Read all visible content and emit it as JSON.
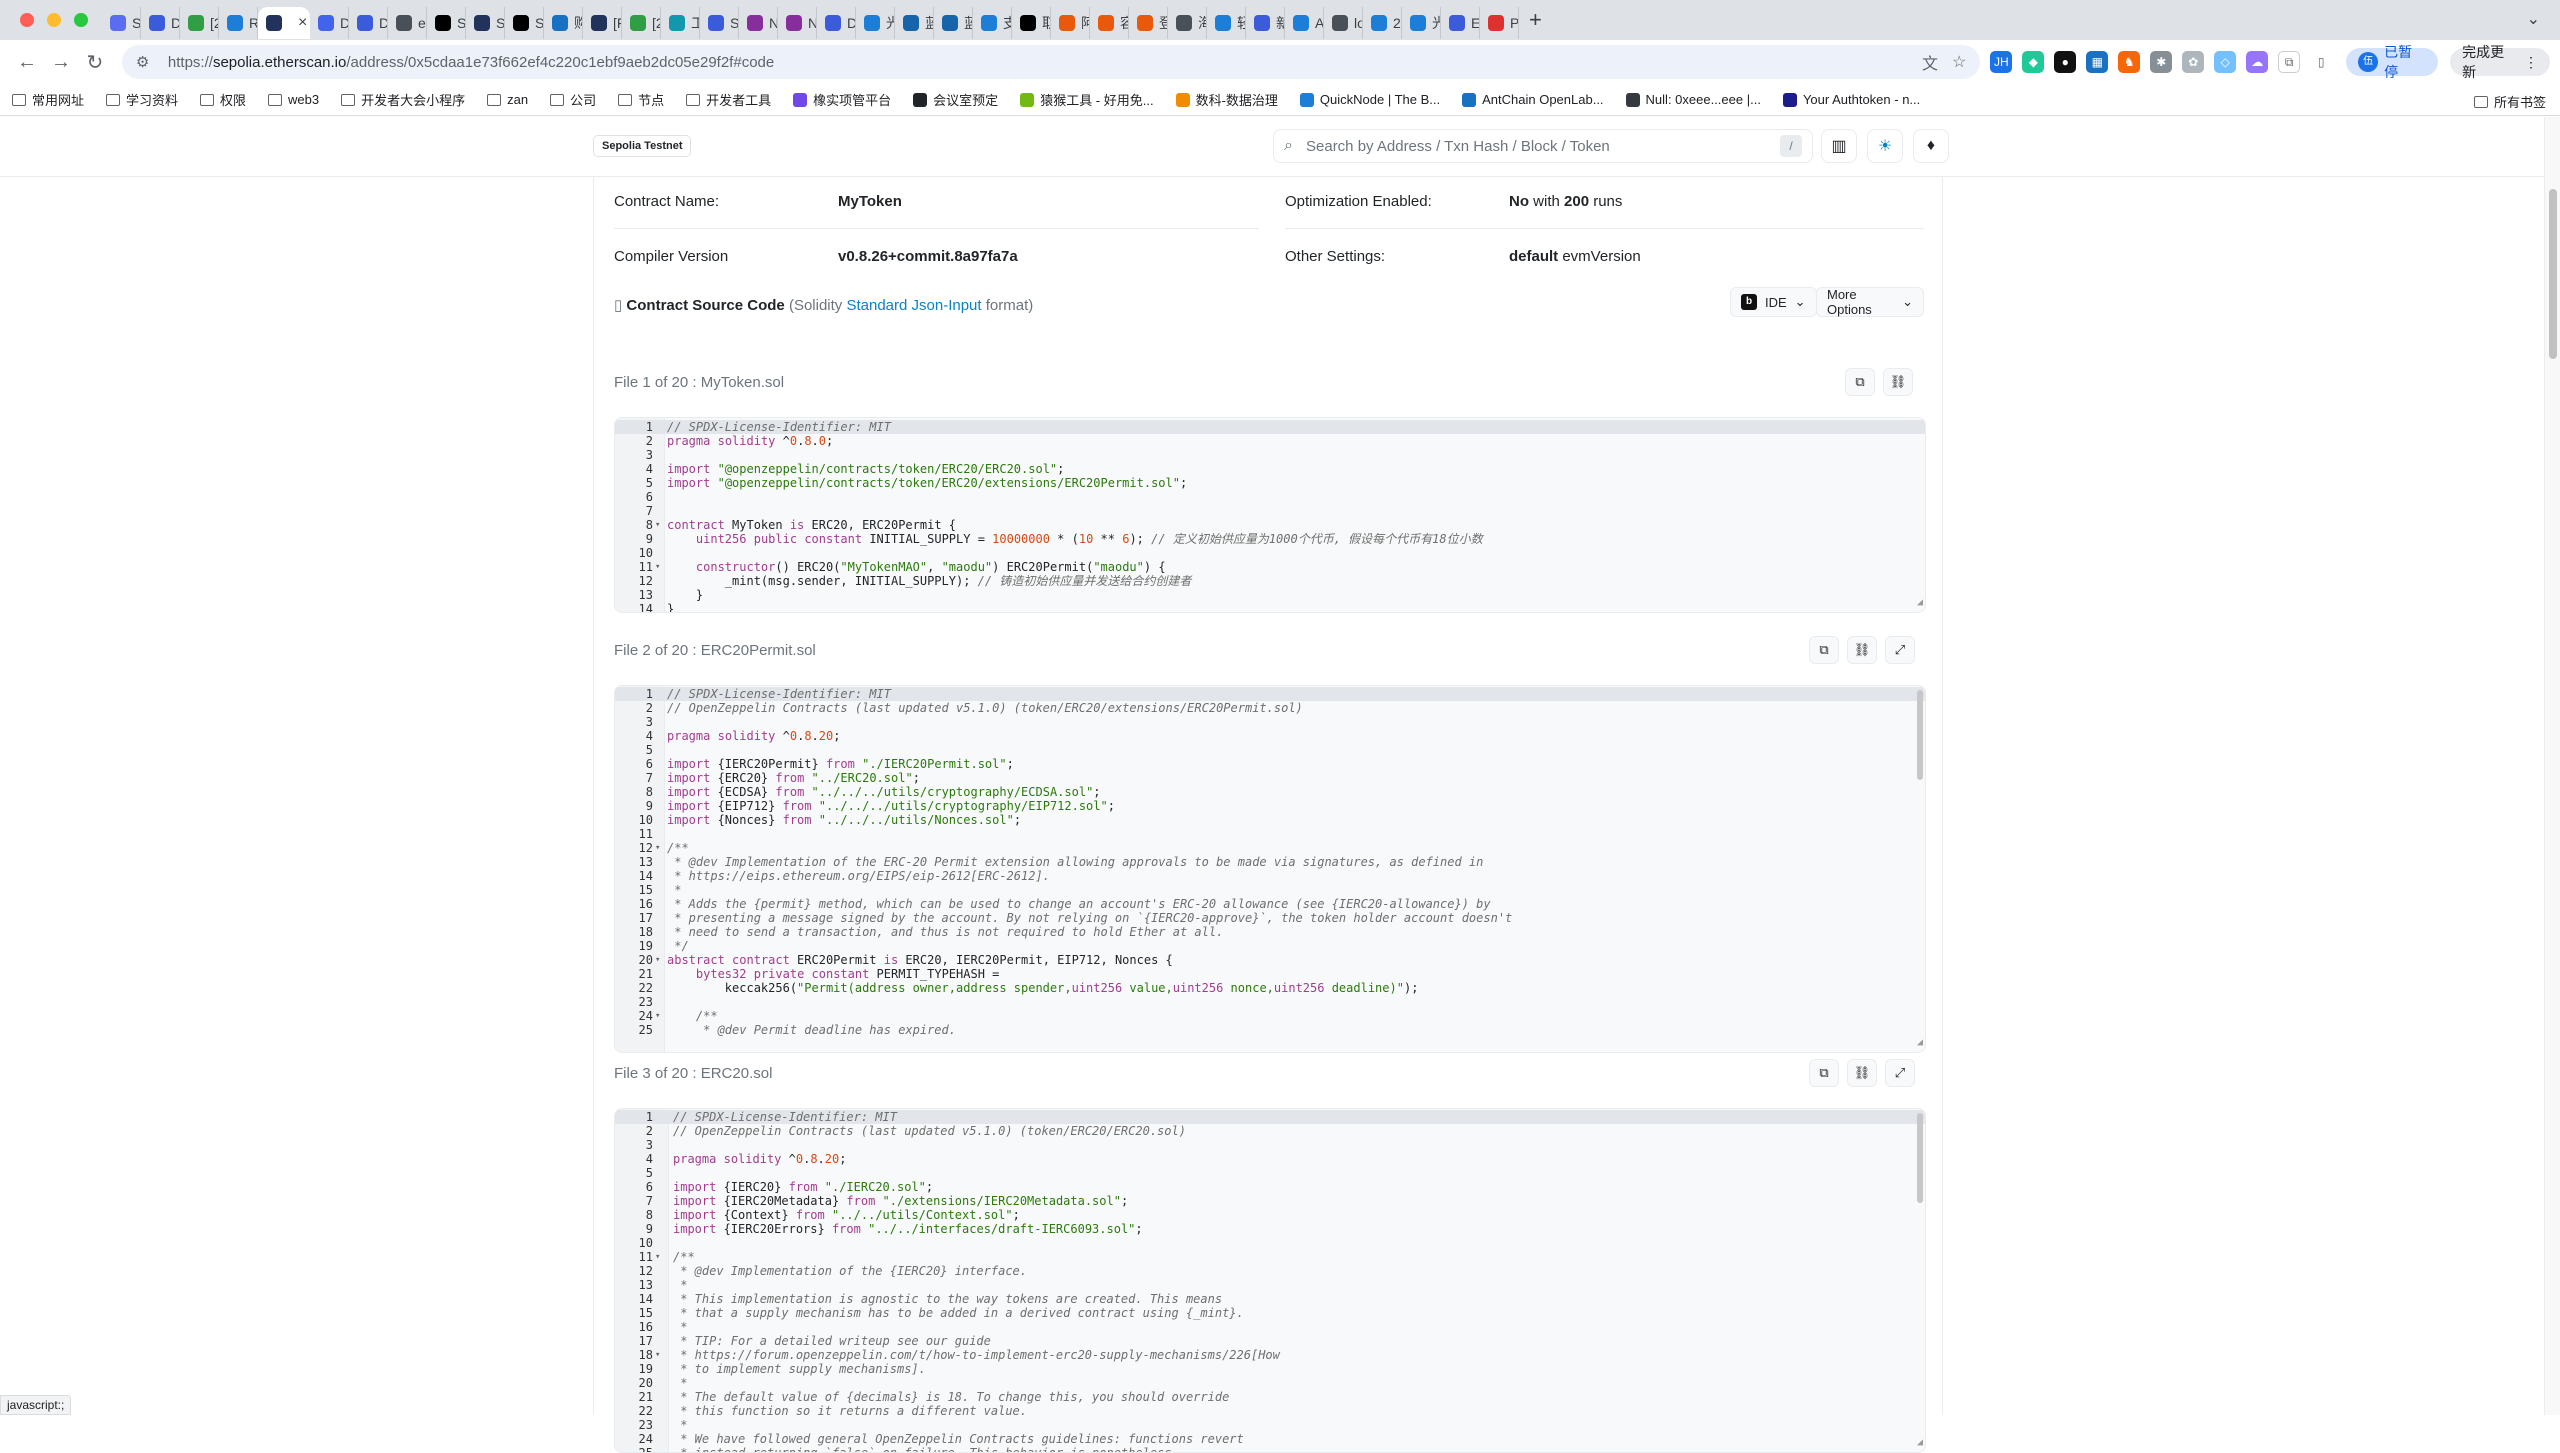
{
  "browser": {
    "tabs": [
      {
        "label": "Se",
        "color": "#5a6cf0"
      },
      {
        "label": "DM",
        "color": "#3b5bdb"
      },
      {
        "label": "[2",
        "color": "#2f9e44"
      },
      {
        "label": "Re",
        "color": "#1c7ed6"
      },
      {
        "label": "",
        "color": "#21325b",
        "active": true
      },
      {
        "label": "Da",
        "color": "#4263eb"
      },
      {
        "label": "DM",
        "color": "#3b5bdb"
      },
      {
        "label": "eth",
        "color": "#495057"
      },
      {
        "label": "Se",
        "color": "#000000"
      },
      {
        "label": "Se",
        "color": "#21325b"
      },
      {
        "label": "Se",
        "color": "#000000"
      },
      {
        "label": "购买",
        "color": "#1971c2"
      },
      {
        "label": "[F",
        "color": "#21325b"
      },
      {
        "label": "[2",
        "color": "#2f9e44"
      },
      {
        "label": "工作",
        "color": "#1098ad"
      },
      {
        "label": "SQ",
        "color": "#3b5bdb"
      },
      {
        "label": "No",
        "color": "#862e9c"
      },
      {
        "label": "No",
        "color": "#862e9c"
      },
      {
        "label": "DM",
        "color": "#3b5bdb"
      },
      {
        "label": "光寸",
        "color": "#1c7ed6"
      },
      {
        "label": "蓝领",
        "color": "#1864ab"
      },
      {
        "label": "蓝领",
        "color": "#1864ab"
      },
      {
        "label": "支付",
        "color": "#1c7ed6"
      },
      {
        "label": "取消",
        "color": "#000000"
      },
      {
        "label": "阿里",
        "color": "#e8590c"
      },
      {
        "label": "容器",
        "color": "#e8590c"
      },
      {
        "label": "登录",
        "color": "#e8590c"
      },
      {
        "label": "海外",
        "color": "#495057"
      },
      {
        "label": "轻松",
        "color": "#1c7ed6"
      },
      {
        "label": "新特",
        "color": "#3b5bdb"
      },
      {
        "label": "An",
        "color": "#1c7ed6"
      },
      {
        "label": "loc",
        "color": "#495057"
      },
      {
        "label": "20",
        "color": "#1c7ed6"
      },
      {
        "label": "光寸",
        "color": "#1c7ed6"
      },
      {
        "label": "Eth",
        "color": "#3b5bdb"
      },
      {
        "label": "Ple",
        "color": "#e03131"
      }
    ],
    "url_prefix": "https://",
    "url_host": "sepolia.etherscan.io",
    "url_path": "/address/0x5cdaa1e73f662ef4c220c1ebf9aeb2dc05e29f2f#code",
    "paused_label": "已暂停",
    "update_label": "完成更新",
    "bookmarks": [
      {
        "label": "常用网址",
        "type": "folder"
      },
      {
        "label": "学习资料",
        "type": "folder"
      },
      {
        "label": "权限",
        "type": "folder"
      },
      {
        "label": "web3",
        "type": "folder"
      },
      {
        "label": "开发者大会小程序",
        "type": "folder"
      },
      {
        "label": "zan",
        "type": "folder"
      },
      {
        "label": "公司",
        "type": "folder"
      },
      {
        "label": "节点",
        "type": "folder"
      },
      {
        "label": "开发者工具",
        "type": "folder"
      },
      {
        "label": "橡实项管平台",
        "type": "site",
        "color": "#7048e8"
      },
      {
        "label": "会议室预定",
        "type": "site",
        "color": "#212529"
      },
      {
        "label": "猿猴工具 - 好用免...",
        "type": "site",
        "color": "#74b816"
      },
      {
        "label": "数科-数据治理",
        "type": "site",
        "color": "#f08c00"
      },
      {
        "label": "QuickNode | The B...",
        "type": "site",
        "color": "#1c7ed6"
      },
      {
        "label": "AntChain OpenLab...",
        "type": "site",
        "color": "#1971c2"
      },
      {
        "label": "Null: 0xeee...eee |...",
        "type": "site",
        "color": "#343a40"
      },
      {
        "label": "Your Authtoken - n...",
        "type": "site",
        "color": "#1c1c8c"
      }
    ],
    "all_bookmarks": "所有书签",
    "status_text": "javascript:;"
  },
  "header": {
    "network": "Sepolia Testnet",
    "search_placeholder": "Search by Address / Txn Hash / Block / Token",
    "slash": "/"
  },
  "contract": {
    "name_label": "Contract Name:",
    "name_value": "MyToken",
    "opt_label": "Optimization Enabled:",
    "opt_value_no": "No",
    "opt_with": " with ",
    "opt_runs": "200",
    "opt_runs_label": " runs",
    "compiler_label": "Compiler Version",
    "compiler_value": "v0.8.26+commit.8a97fa7a",
    "other_label": "Other Settings:",
    "other_default": "default",
    "other_evm": " evmVersion",
    "source_title": "Contract Source Code",
    "source_paren_open": " (Solidity ",
    "source_link": "Standard Json-Input",
    "source_paren_close": " format)",
    "ide_label": "IDE",
    "more_label": "More Options"
  },
  "files": [
    {
      "title": "File 1 of 20 : MyToken.sol",
      "lines": [
        {
          "n": "1",
          "t": "// SPDX-License-Identifier: MIT",
          "c": "cm"
        },
        {
          "n": "2",
          "t": "pragma solidity ^0.8.0;"
        },
        {
          "n": "3",
          "t": ""
        },
        {
          "n": "4",
          "t": "import \"@openzeppelin/contracts/token/ERC20/ERC20.sol\";"
        },
        {
          "n": "5",
          "t": "import \"@openzeppelin/contracts/token/ERC20/extensions/ERC20Permit.sol\";"
        },
        {
          "n": "6",
          "t": ""
        },
        {
          "n": "7",
          "t": ""
        },
        {
          "n": "8",
          "t": "contract MyToken is ERC20, ERC20Permit {",
          "f": true
        },
        {
          "n": "9",
          "t": "    uint256 public constant INITIAL_SUPPLY = 10000000 * (10 ** 6); // 定义初始供应量为1000个代币, 假设每个代币有18位小数"
        },
        {
          "n": "10",
          "t": ""
        },
        {
          "n": "11",
          "t": "    constructor() ERC20(\"MyTokenMAO\", \"maodu\") ERC20Permit(\"maodu\") {",
          "f": true
        },
        {
          "n": "12",
          "t": "        _mint(msg.sender, INITIAL_SUPPLY); // 铸造初始供应量并发送给合约创建者"
        },
        {
          "n": "13",
          "t": "    }"
        },
        {
          "n": "14",
          "t": "}"
        }
      ]
    },
    {
      "title": "File 2 of 20 : ERC20Permit.sol",
      "lines": [
        {
          "n": "1",
          "t": "// SPDX-License-Identifier: MIT",
          "c": "cm"
        },
        {
          "n": "2",
          "t": "// OpenZeppelin Contracts (last updated v5.1.0) (token/ERC20/extensions/ERC20Permit.sol)",
          "c": "cm"
        },
        {
          "n": "3",
          "t": ""
        },
        {
          "n": "4",
          "t": "pragma solidity ^0.8.20;"
        },
        {
          "n": "5",
          "t": ""
        },
        {
          "n": "6",
          "t": "import {IERC20Permit} from \"./IERC20Permit.sol\";"
        },
        {
          "n": "7",
          "t": "import {ERC20} from \"../ERC20.sol\";"
        },
        {
          "n": "8",
          "t": "import {ECDSA} from \"../../../utils/cryptography/ECDSA.sol\";"
        },
        {
          "n": "9",
          "t": "import {EIP712} from \"../../../utils/cryptography/EIP712.sol\";"
        },
        {
          "n": "10",
          "t": "import {Nonces} from \"../../../utils/Nonces.sol\";"
        },
        {
          "n": "11",
          "t": ""
        },
        {
          "n": "12",
          "t": "/**",
          "c": "cm",
          "f": true
        },
        {
          "n": "13",
          "t": " * @dev Implementation of the ERC-20 Permit extension allowing approvals to be made via signatures, as defined in",
          "c": "cm"
        },
        {
          "n": "14",
          "t": " * https://eips.ethereum.org/EIPS/eip-2612[ERC-2612].",
          "c": "cm"
        },
        {
          "n": "15",
          "t": " *",
          "c": "cm"
        },
        {
          "n": "16",
          "t": " * Adds the {permit} method, which can be used to change an account's ERC-20 allowance (see {IERC20-allowance}) by",
          "c": "cm"
        },
        {
          "n": "17",
          "t": " * presenting a message signed by the account. By not relying on `{IERC20-approve}`, the token holder account doesn't",
          "c": "cm"
        },
        {
          "n": "18",
          "t": " * need to send a transaction, and thus is not required to hold Ether at all.",
          "c": "cm"
        },
        {
          "n": "19",
          "t": " */",
          "c": "cm"
        },
        {
          "n": "20",
          "t": "abstract contract ERC20Permit is ERC20, IERC20Permit, EIP712, Nonces {",
          "f": true
        },
        {
          "n": "21",
          "t": "    bytes32 private constant PERMIT_TYPEHASH ="
        },
        {
          "n": "22",
          "t": "        keccak256(\"Permit(address owner,address spender,uint256 value,uint256 nonce,uint256 deadline)\");"
        },
        {
          "n": "23",
          "t": ""
        },
        {
          "n": "24",
          "t": "    /**",
          "c": "cm",
          "f": true
        },
        {
          "n": "25",
          "t": "     * @dev Permit deadline has expired.",
          "c": "cm"
        }
      ]
    },
    {
      "title": "File 3 of 20 : ERC20.sol",
      "lines": [
        {
          "n": "1",
          "t": "// SPDX-License-Identifier: MIT",
          "c": "cm"
        },
        {
          "n": "2",
          "t": "// OpenZeppelin Contracts (last updated v5.1.0) (token/ERC20/ERC20.sol)",
          "c": "cm"
        },
        {
          "n": "3",
          "t": ""
        },
        {
          "n": "4",
          "t": "pragma solidity ^0.8.20;"
        },
        {
          "n": "5",
          "t": ""
        },
        {
          "n": "6",
          "t": "import {IERC20} from \"./IERC20.sol\";"
        },
        {
          "n": "7",
          "t": "import {IERC20Metadata} from \"./extensions/IERC20Metadata.sol\";"
        },
        {
          "n": "8",
          "t": "import {Context} from \"../../utils/Context.sol\";"
        },
        {
          "n": "9",
          "t": "import {IERC20Errors} from \"../../interfaces/draft-IERC6093.sol\";"
        },
        {
          "n": "10",
          "t": ""
        },
        {
          "n": "11",
          "t": "/**",
          "c": "cm",
          "f": true
        },
        {
          "n": "12",
          "t": " * @dev Implementation of the {IERC20} interface.",
          "c": "cm"
        },
        {
          "n": "13",
          "t": " *",
          "c": "cm"
        },
        {
          "n": "14",
          "t": " * This implementation is agnostic to the way tokens are created. This means",
          "c": "cm"
        },
        {
          "n": "15",
          "t": " * that a supply mechanism has to be added in a derived contract using {_mint}.",
          "c": "cm"
        },
        {
          "n": "16",
          "t": " *",
          "c": "cm"
        },
        {
          "n": "17",
          "t": " * TIP: For a detailed writeup see our guide",
          "c": "cm"
        },
        {
          "n": "18",
          "t": " * https://forum.openzeppelin.com/t/how-to-implement-erc20-supply-mechanisms/226[How",
          "c": "cm",
          "f": true
        },
        {
          "n": "19",
          "t": " * to implement supply mechanisms].",
          "c": "cm"
        },
        {
          "n": "20",
          "t": " *",
          "c": "cm"
        },
        {
          "n": "21",
          "t": " * The default value of {decimals} is 18. To change this, you should override",
          "c": "cm"
        },
        {
          "n": "22",
          "t": " * this function so it returns a different value.",
          "c": "cm"
        },
        {
          "n": "23",
          "t": " *",
          "c": "cm"
        },
        {
          "n": "24",
          "t": " * We have followed general OpenZeppelin Contracts guidelines: functions revert",
          "c": "cm"
        },
        {
          "n": "25",
          "t": " * instead returning `false` on failure. This behavior is nonetheless",
          "c": "cm"
        }
      ]
    }
  ]
}
